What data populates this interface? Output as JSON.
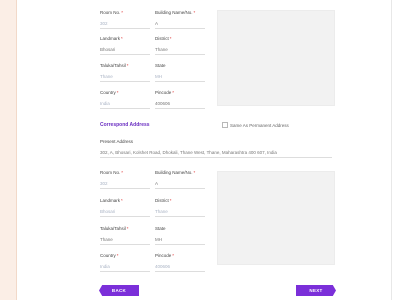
{
  "block1": {
    "room_no": {
      "label": "Room No.",
      "value": "302",
      "placeholder": true
    },
    "building_name": {
      "label": "Building Name/No.",
      "value": "A",
      "placeholder": false
    },
    "landmark": {
      "label": "Landmark",
      "value": "Bhosari",
      "placeholder": false
    },
    "district": {
      "label": "District",
      "value": "Thane",
      "placeholder": false
    },
    "taluka": {
      "label": "Taluka/Tahsil",
      "value": "Thane",
      "placeholder": false
    },
    "state": {
      "label": "State",
      "value": "MH",
      "placeholder": false
    },
    "country": {
      "label": "Country",
      "value": "India",
      "placeholder": true
    },
    "pincode": {
      "label": "Pincode",
      "value": "400606",
      "placeholder": false
    }
  },
  "correspondence_title": "Correspond Address",
  "same_as_permanent": {
    "label": "Same As Permanent Address",
    "checked": false
  },
  "present_address": {
    "label": "Present Address",
    "value": "302, A, Bhosari, Kolshet Road, Dhokali, Thane West, Thane, Maharashtra 400 607, India"
  },
  "block2": {
    "room_no": {
      "label": "Room No.",
      "value": "302",
      "placeholder": true
    },
    "building_name": {
      "label": "Building Name/No.",
      "value": "A",
      "placeholder": false
    },
    "landmark": {
      "label": "Landmark",
      "value": "Bhosari",
      "placeholder": true
    },
    "district": {
      "label": "District",
      "value": "Thane",
      "placeholder": true
    },
    "taluka": {
      "label": "Taluka/Tahsil",
      "value": "Thane",
      "placeholder": false
    },
    "state": {
      "label": "State",
      "value": "MH",
      "placeholder": false
    },
    "country": {
      "label": "Country",
      "value": "India",
      "placeholder": true
    },
    "pincode": {
      "label": "Pincode",
      "value": "400606",
      "placeholder": false
    }
  },
  "buttons": {
    "back": "BACK",
    "next": "NEXT"
  },
  "colors": {
    "accent": "#7b2fd9",
    "strip": "#fbeee6"
  }
}
